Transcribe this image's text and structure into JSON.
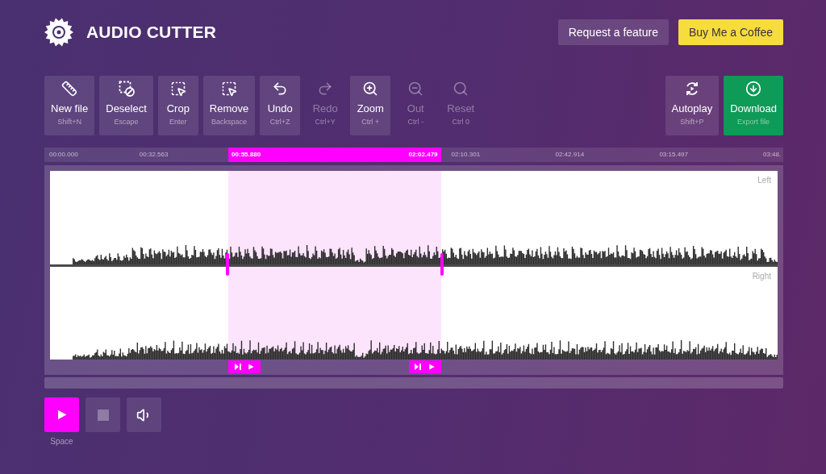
{
  "header": {
    "title": "AUDIO CUTTER",
    "links": [
      {
        "label": "Request a feature",
        "kind": "feature"
      },
      {
        "label": "Buy Me a Coffee",
        "kind": "coffee"
      }
    ]
  },
  "toolbar": {
    "left": [
      {
        "kind": "new",
        "label": "New file",
        "hint": "Shift+N",
        "disabled": false
      },
      {
        "kind": "deselect",
        "label": "Deselect",
        "hint": "Escape",
        "disabled": false
      },
      {
        "kind": "crop",
        "label": "Crop",
        "hint": "Enter",
        "disabled": false
      },
      {
        "kind": "remove",
        "label": "Remove",
        "hint": "Backspace",
        "disabled": false
      },
      {
        "kind": "undo",
        "label": "Undo",
        "hint": "Ctrl+Z",
        "disabled": false
      },
      {
        "kind": "redo",
        "label": "Redo",
        "hint": "Ctrl+Y",
        "disabled": true
      },
      {
        "kind": "zoomin",
        "label": "Zoom",
        "hint": "Ctrl +",
        "disabled": false
      },
      {
        "kind": "zoomout",
        "label": "Out",
        "hint": "Ctrl -",
        "disabled": true
      },
      {
        "kind": "reset",
        "label": "Reset",
        "hint": "Ctrl 0",
        "disabled": true
      }
    ],
    "right": [
      {
        "kind": "autoplay",
        "label": "Autoplay",
        "hint": "Shift+P"
      },
      {
        "kind": "download",
        "label": "Download",
        "hint": "Export file"
      }
    ]
  },
  "timeline": {
    "ticks": [
      "00:00.000",
      "00:32.563",
      "02:10.301",
      "02:42.914",
      "03:15.497",
      "03:48."
    ],
    "selection": {
      "start": "00:55.880",
      "end": "02:02.479"
    }
  },
  "channels": [
    {
      "label": "Left"
    },
    {
      "label": "Right"
    }
  ],
  "transport": [
    {
      "kind": "play",
      "hint": "Space",
      "disabled": false
    },
    {
      "kind": "stop",
      "disabled": true
    },
    {
      "kind": "volume",
      "disabled": false
    }
  ]
}
